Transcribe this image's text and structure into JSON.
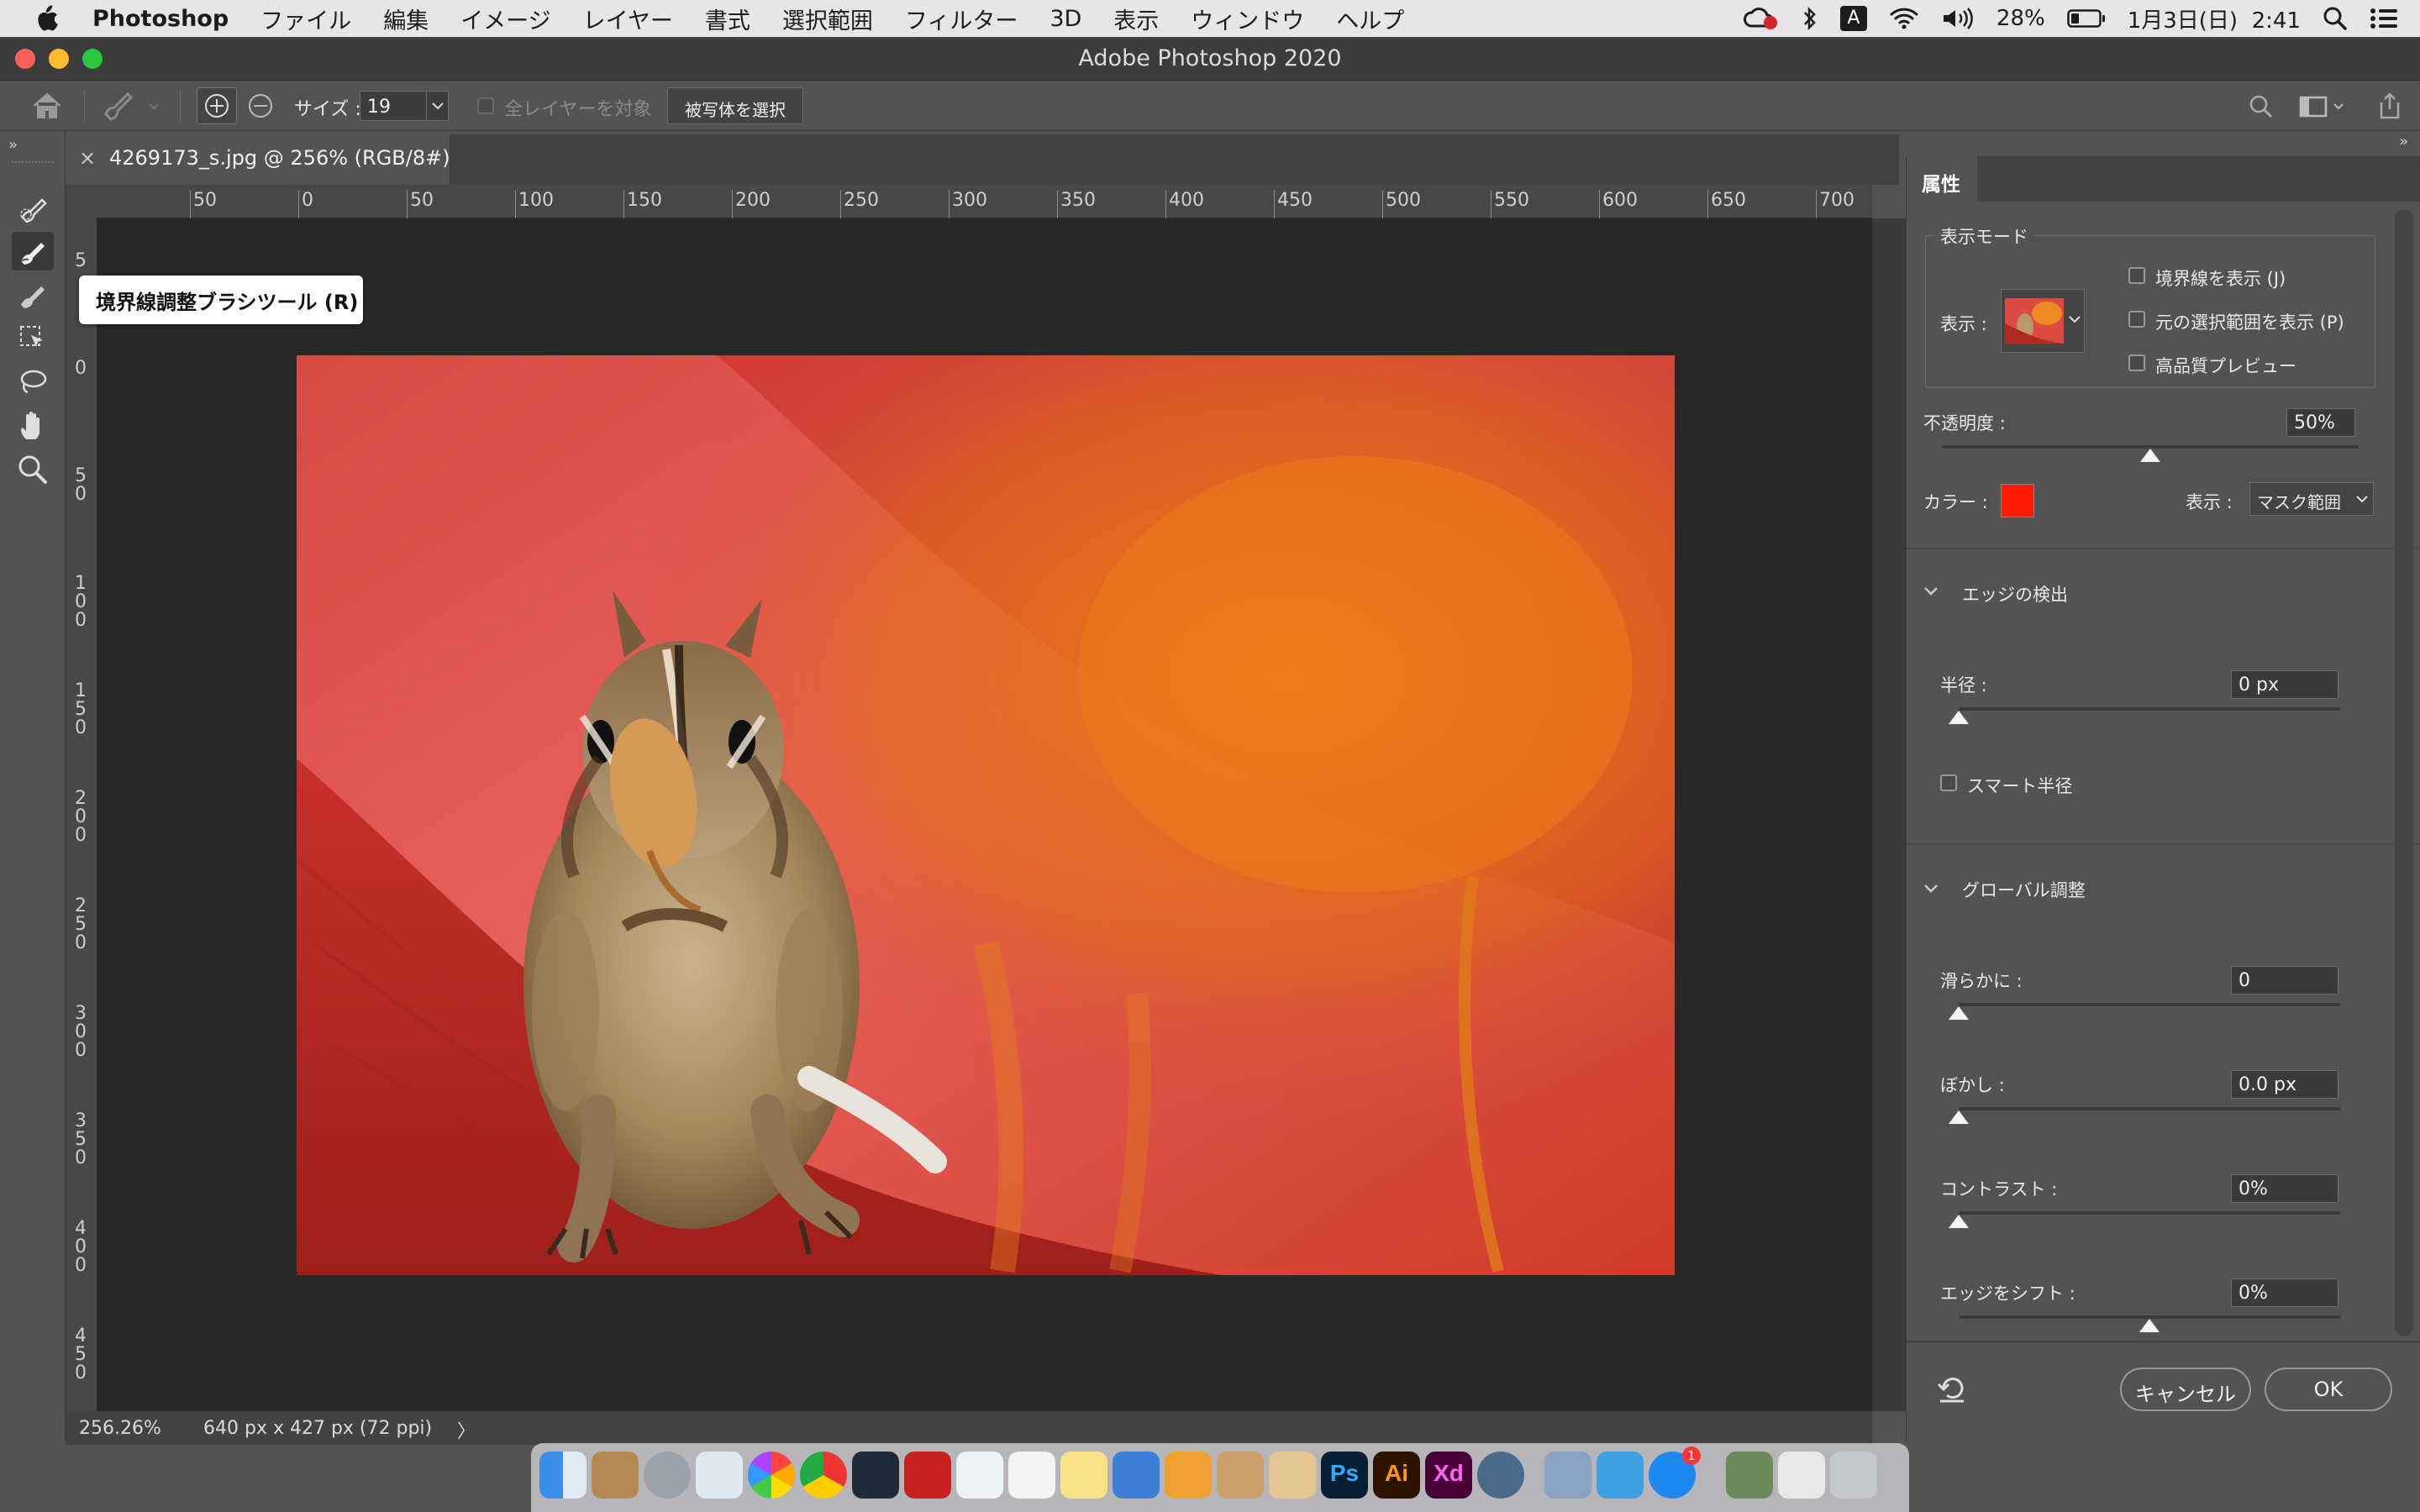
{
  "menubar": {
    "app": "Photoshop",
    "items": [
      "ファイル",
      "編集",
      "イメージ",
      "レイヤー",
      "書式",
      "選択範囲",
      "フィルター",
      "3D",
      "表示",
      "ウィンドウ",
      "ヘルプ"
    ],
    "input_badge": "A",
    "battery": "28%",
    "datetime": "1月3日(日)  2:41"
  },
  "window": {
    "title": "Adobe Photoshop 2020"
  },
  "options": {
    "size_label": "サイズ :",
    "size_value": "19",
    "all_layers_label": "全レイヤーを対象",
    "select_subject_button": "被写体を選択"
  },
  "document": {
    "tab_label": "4269173_s.jpg @ 256% (RGB/8#)",
    "close_glyph": "×"
  },
  "ruler": {
    "h_ticks": [
      "50",
      "0",
      "50",
      "100",
      "150",
      "200",
      "250",
      "300",
      "350",
      "400",
      "450",
      "500",
      "550",
      "600",
      "650",
      "700"
    ],
    "v_ticks": [
      "5",
      "0",
      "5 0",
      "1 0 0",
      "1 5 0",
      "2 0 0",
      "2 5 0",
      "3 0 0",
      "3 5 0",
      "4 0 0",
      "4 5 0"
    ]
  },
  "tooltip": {
    "text": "境界線調整ブラシツール (R)"
  },
  "status": {
    "zoom": "256.26%",
    "doc_info": "640 px x 427 px (72 ppi)",
    "arrow": "〉"
  },
  "panel": {
    "tab": "属性",
    "view_mode_title": "表示モード",
    "view_label": "表示 :",
    "checks": [
      "境界線を表示 (J)",
      "元の選択範囲を表示 (P)",
      "高品質プレビュー"
    ],
    "opacity_label": "不透明度 :",
    "opacity_value": "50%",
    "opacity_level": 0.5,
    "color_label": "カラー :",
    "overlay_color": "#ff1a00",
    "display_label": "表示 :",
    "display_value": "マスク範囲",
    "edge_section": "エッジの検出",
    "radius_label": "半径 :",
    "radius_value": "0 px",
    "smart_radius": "スマート半径",
    "global_section": "グローバル調整",
    "smooth_label": "滑らかに :",
    "smooth_value": "0",
    "feather_label": "ぼかし :",
    "feather_value": "0.0 px",
    "contrast_label": "コントラスト :",
    "contrast_value": "0%",
    "shift_label": "エッジをシフト :",
    "shift_value": "0%",
    "cancel_button": "キャンセル",
    "ok_button": "OK"
  },
  "dock": {
    "ps": "Ps",
    "ai": "Ai",
    "xd": "Xd",
    "appstore_badge": "1"
  }
}
